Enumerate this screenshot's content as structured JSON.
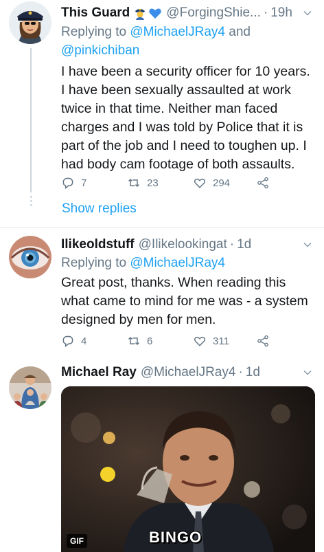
{
  "tweets": [
    {
      "name": "This Guard",
      "badges": [
        "police-officer-emoji",
        "blue-heart-emoji"
      ],
      "handle": "@ForgingShie...",
      "time": "19h",
      "replying_prefix": "Replying to",
      "mentions": [
        "@MichaelJRay4",
        "@pinkichiban"
      ],
      "mention_joiner": "and",
      "text_lines": [
        "I have been a security officer for 10 years.",
        "I have been sexually assaulted at work",
        "twice in that time. Neither man faced",
        "charges and I was told by Police that it is",
        "part of the job and I need to toughen up. I",
        "had body cam footage of both assaults."
      ],
      "replies": "7",
      "retweets": "23",
      "likes": "294",
      "show_replies": "Show replies"
    },
    {
      "name": "Ilikeoldstuff",
      "handle": "@Ilikelookingat",
      "time": "1d",
      "replying_prefix": "Replying to",
      "mentions": [
        "@MichaelJRay4"
      ],
      "text_lines": [
        "Great post, thanks. When reading this",
        "what came to mind for me was - a system",
        "designed by men for men."
      ],
      "replies": "4",
      "retweets": "6",
      "likes": "311"
    },
    {
      "name": "Michael Ray",
      "handle": "@MichaelJRay4",
      "time": "1d",
      "media": {
        "badge": "GIF",
        "caption": "BINGO"
      }
    }
  ],
  "dot_separator": "·",
  "icons": {
    "reply": "reply-icon",
    "retweet": "retweet-icon",
    "like": "like-icon",
    "share": "share-icon",
    "more": "chevron-down-icon"
  },
  "colors": {
    "accent": "#1da1f2",
    "secondary": "#657786",
    "text": "#14171a",
    "divider": "#e6ecf0"
  }
}
